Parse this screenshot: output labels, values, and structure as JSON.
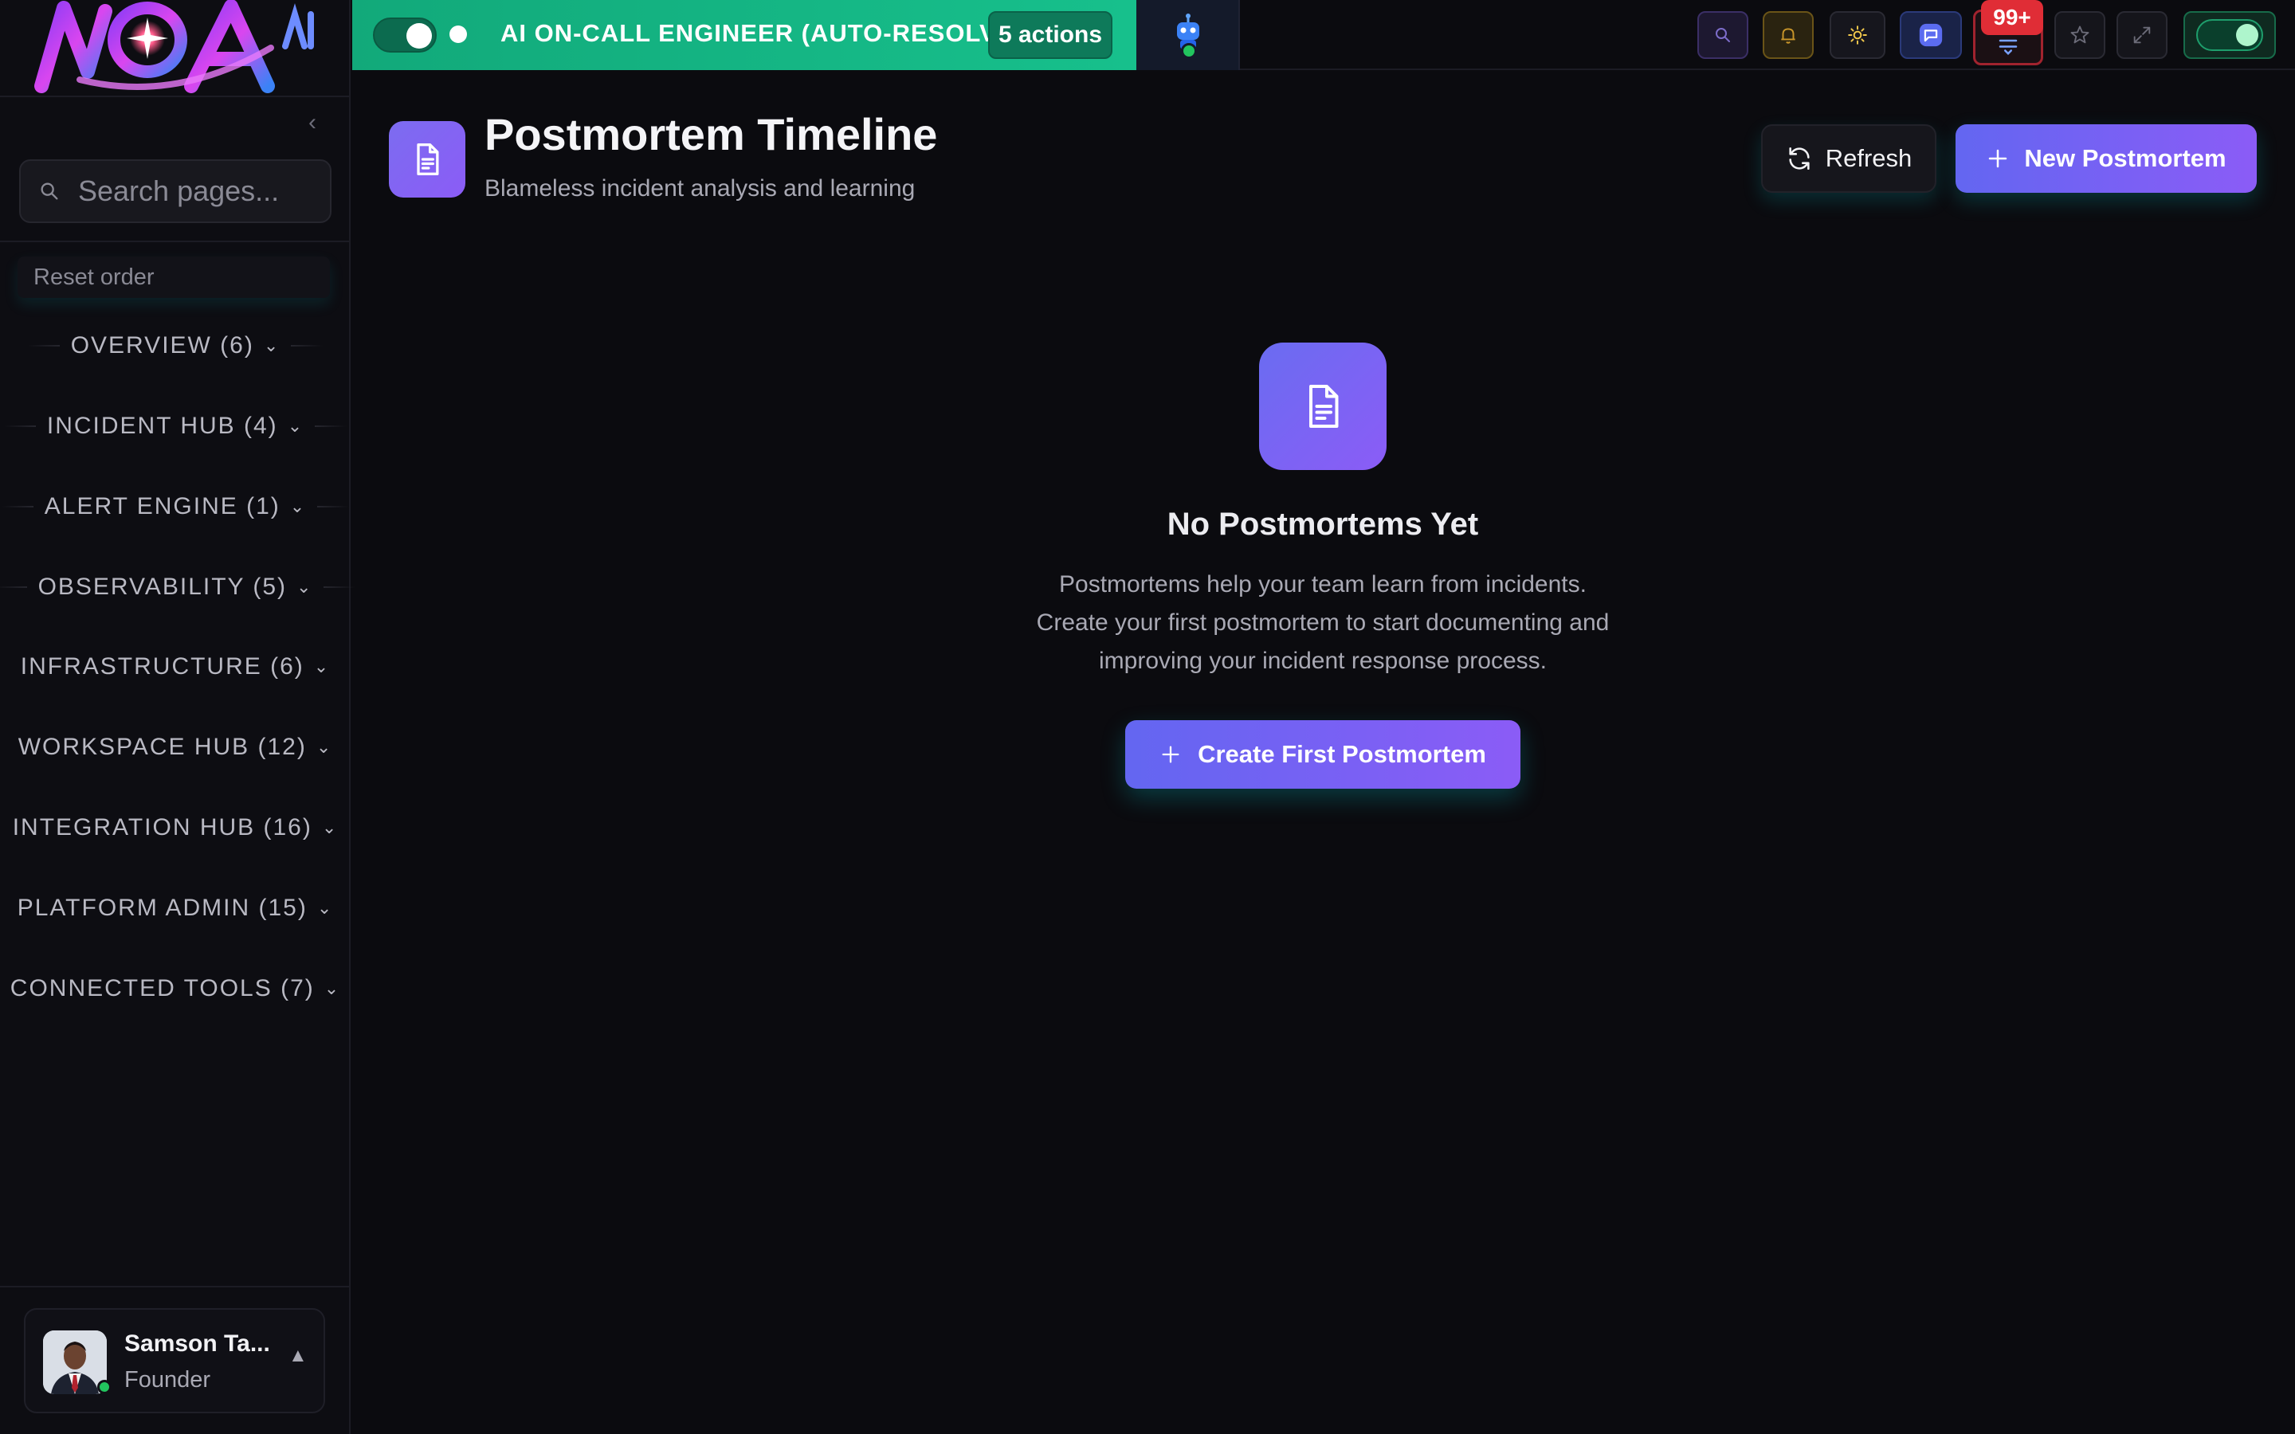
{
  "sidebar": {
    "search_placeholder": "Search pages...",
    "reset_order_label": "Reset order",
    "nav": [
      {
        "label": "OVERVIEW (6)"
      },
      {
        "label": "INCIDENT HUB (4)"
      },
      {
        "label": "ALERT ENGINE (1)"
      },
      {
        "label": "OBSERVABILITY (5)"
      },
      {
        "label": "INFRASTRUCTURE (6)"
      },
      {
        "label": "WORKSPACE HUB (12)"
      },
      {
        "label": "INTEGRATION HUB (16)"
      },
      {
        "label": "PLATFORM ADMIN (15)"
      },
      {
        "label": "CONNECTED TOOLS (7)"
      }
    ],
    "user": {
      "name": "Samson Ta...",
      "role": "Founder",
      "status": "online"
    }
  },
  "topbar": {
    "ai_banner_label": "AI ON-CALL ENGINEER (AUTO-RESOLVE)",
    "ai_actions_label": "5 actions",
    "notification_badge": "99+",
    "icons": [
      "search-icon",
      "bell-icon",
      "sun-icon",
      "chat-icon",
      "notification-icon",
      "star-icon",
      "expand-icon",
      "power-toggle"
    ]
  },
  "header": {
    "title": "Postmortem Timeline",
    "subtitle": "Blameless incident analysis and learning",
    "refresh_label": "Refresh",
    "new_label": "New Postmortem"
  },
  "empty_state": {
    "title": "No Postmortems Yet",
    "line1": "Postmortems help your team learn from incidents.",
    "line2": "Create your first postmortem to start documenting and",
    "line3": "improving your incident response process.",
    "cta_label": "Create First Postmortem"
  },
  "colors": {
    "background": "#0b0b0f",
    "accent_green": "#17c08c",
    "accent_purple": "#8b5cf6",
    "accent_indigo": "#6366f1",
    "badge_red": "#e02d36"
  }
}
